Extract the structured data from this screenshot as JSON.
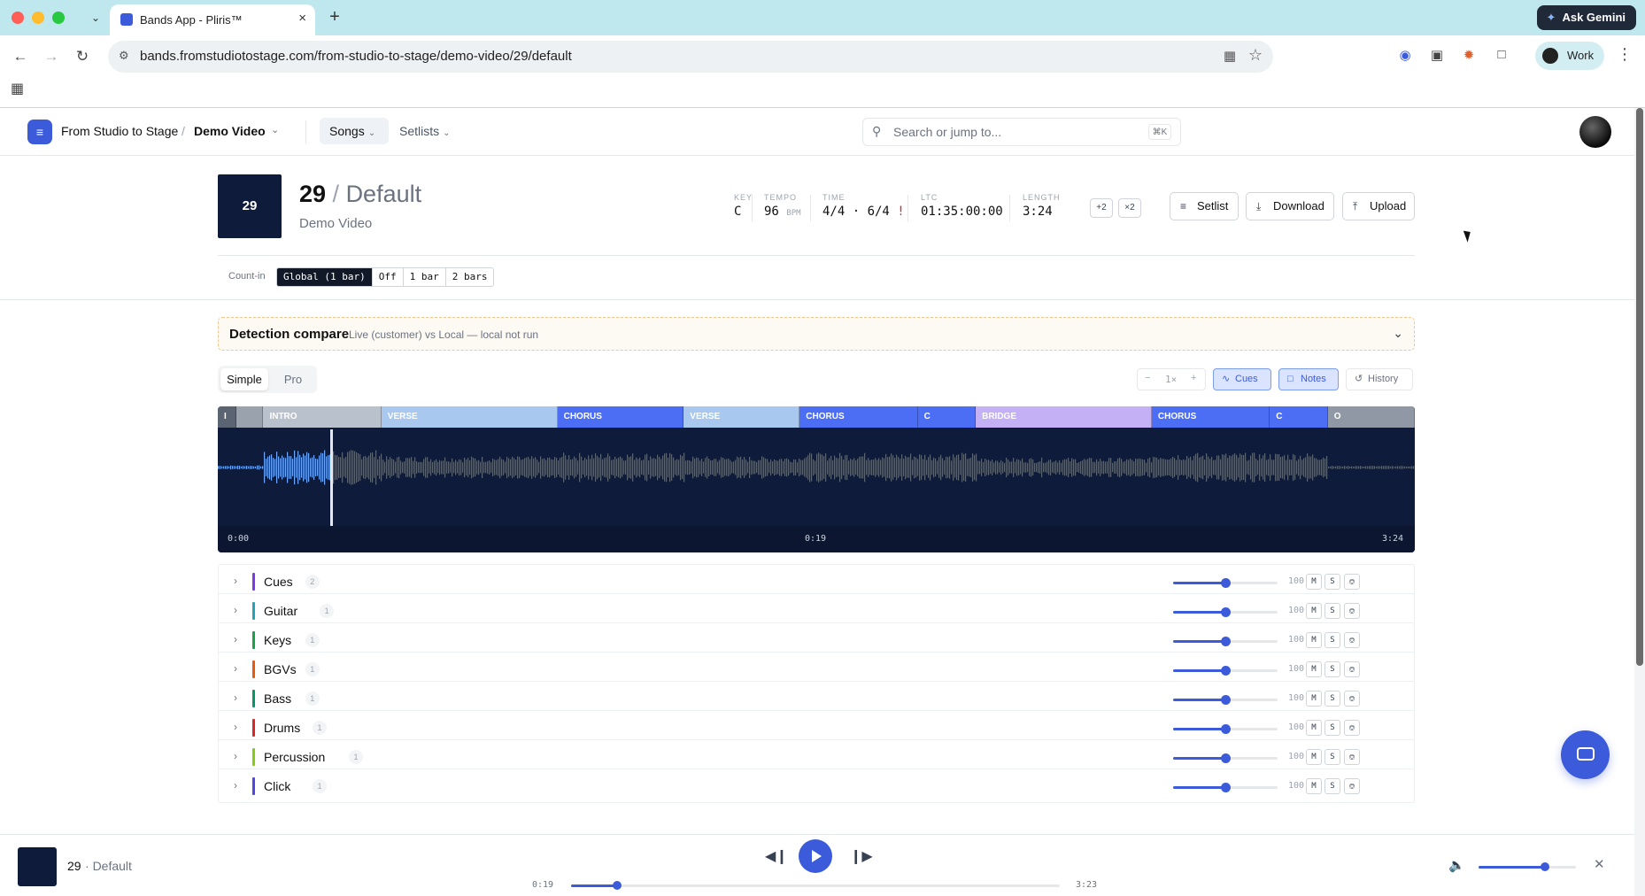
{
  "browser": {
    "tab_title": "Bands App - Pliris™",
    "tab_close": "×",
    "new_tab": "+",
    "tab_menu": "⌄",
    "ask_gemini": "Ask Gemini",
    "url": "bands.fromstudiotostage.com/from-studio-to-stage/demo-video/29/default",
    "profile": "Work",
    "icons": [
      "back-icon",
      "forward-icon",
      "reload-icon",
      "site-info-icon",
      "reader-mode-icon",
      "bookmark-star-icon",
      "password-manager-icon",
      "camera-icon",
      "claude-icon",
      "extensions-icon",
      "chrome-menu-icon",
      "apps-grid-icon"
    ]
  },
  "app": {
    "org": "From Studio to Stage",
    "crumb_sep": "/",
    "project": "Demo Video",
    "nav": {
      "songs": "Songs",
      "setlists": "Setlists"
    },
    "search_placeholder": "Search or jump to...",
    "search_shortcut": "⌘K",
    "colors": {
      "accent": "#3b5bdb",
      "navy": "#0f1b3a"
    }
  },
  "song": {
    "thumb_label": "29",
    "number": "29",
    "title_sep": " / ",
    "variant": "Default",
    "project": "Demo Video",
    "meta": {
      "key_label": "KEY",
      "key": "C",
      "tempo_label": "TEMPO",
      "tempo": "96",
      "tempo_unit": "BPM",
      "time_label": "TIME",
      "time": "4/4 · 6/4",
      "time_warn": "!",
      "ltc_label": "LTC",
      "ltc": "01:35:00:00",
      "length_label": "LENGTH",
      "length": "3:24"
    },
    "transpose": [
      "+2",
      "×2"
    ],
    "actions": {
      "setlist": "Setlist",
      "download": "Download",
      "upload": "Upload"
    }
  },
  "countin": {
    "label": "Count-in",
    "options": [
      "Global (1 bar)",
      "Off",
      "1 bar",
      "2 bars"
    ],
    "selected": 0
  },
  "detection": {
    "title": "Detection compare",
    "subtitle": "Live (customer) vs Local — local not run"
  },
  "view": {
    "modes": [
      "Simple",
      "Pro"
    ],
    "selected_mode": "Simple",
    "zoom": {
      "minus": "−",
      "level": "1×",
      "plus": "+"
    },
    "toggles": {
      "cues": "Cues",
      "notes": "Notes",
      "history": "History"
    }
  },
  "waveform": {
    "sections": [
      {
        "label": "I",
        "start": 0.0,
        "end": 0.9,
        "color": "#5b6472"
      },
      {
        "label": "",
        "start": 0.9,
        "end": 2.2,
        "color": "#9aa2ad"
      },
      {
        "label": "INTRO",
        "start": 2.2,
        "end": 7.9,
        "color": "#b9c1cc"
      },
      {
        "label": "VERSE",
        "start": 7.9,
        "end": 16.4,
        "color": "#a8c8f0"
      },
      {
        "label": "CHORUS",
        "start": 16.4,
        "end": 22.5,
        "color": "#4c6ef5"
      },
      {
        "label": "VERSE",
        "start": 22.5,
        "end": 28.1,
        "color": "#a8c8f0"
      },
      {
        "label": "CHORUS",
        "start": 28.1,
        "end": 33.8,
        "color": "#4c6ef5"
      },
      {
        "label": "C",
        "start": 33.8,
        "end": 36.6,
        "color": "#4c6ef5"
      },
      {
        "label": "BRIDGE",
        "start": 36.6,
        "end": 45.1,
        "color": "#c4b0f5"
      },
      {
        "label": "CHORUS",
        "start": 45.1,
        "end": 50.8,
        "color": "#4c6ef5"
      },
      {
        "label": "C",
        "start": 50.8,
        "end": 53.6,
        "color": "#4c6ef5"
      },
      {
        "label": "O",
        "start": 53.6,
        "end": 57.8,
        "color": "#8f98a4"
      }
    ],
    "total_units": 57.8,
    "played_fraction": 0.094,
    "time_start": "0:00",
    "time_mid": "0:19",
    "time_end": "3:24"
  },
  "tracks": [
    {
      "name": "Cues",
      "count": "2",
      "color": "#7c3aed",
      "volume": "100",
      "level": 0.5
    },
    {
      "name": "Guitar",
      "count": "1",
      "color": "#22a5b8",
      "volume": "100",
      "level": 0.5
    },
    {
      "name": "Keys",
      "count": "1",
      "color": "#16a34a",
      "volume": "100",
      "level": 0.5
    },
    {
      "name": "BGVs",
      "count": "1",
      "color": "#ea580c",
      "volume": "100",
      "level": 0.5
    },
    {
      "name": "Bass",
      "count": "1",
      "color": "#059669",
      "volume": "100",
      "level": 0.5
    },
    {
      "name": "Drums",
      "count": "1",
      "color": "#dc2626",
      "volume": "100",
      "level": 0.5
    },
    {
      "name": "Percussion",
      "count": "1",
      "color": "#84cc16",
      "volume": "100",
      "level": 0.5
    },
    {
      "name": "Click",
      "count": "1",
      "color": "#4f46e5",
      "volume": "100",
      "level": 0.5
    }
  ],
  "track_buttons": {
    "mute": "M",
    "solo": "S",
    "listen": "☊"
  },
  "player": {
    "song": "29",
    "variant_sep": "·",
    "variant": "Default",
    "elapsed": "0:19",
    "remaining": "3:23",
    "progress": 0.094,
    "volume": 0.68
  }
}
